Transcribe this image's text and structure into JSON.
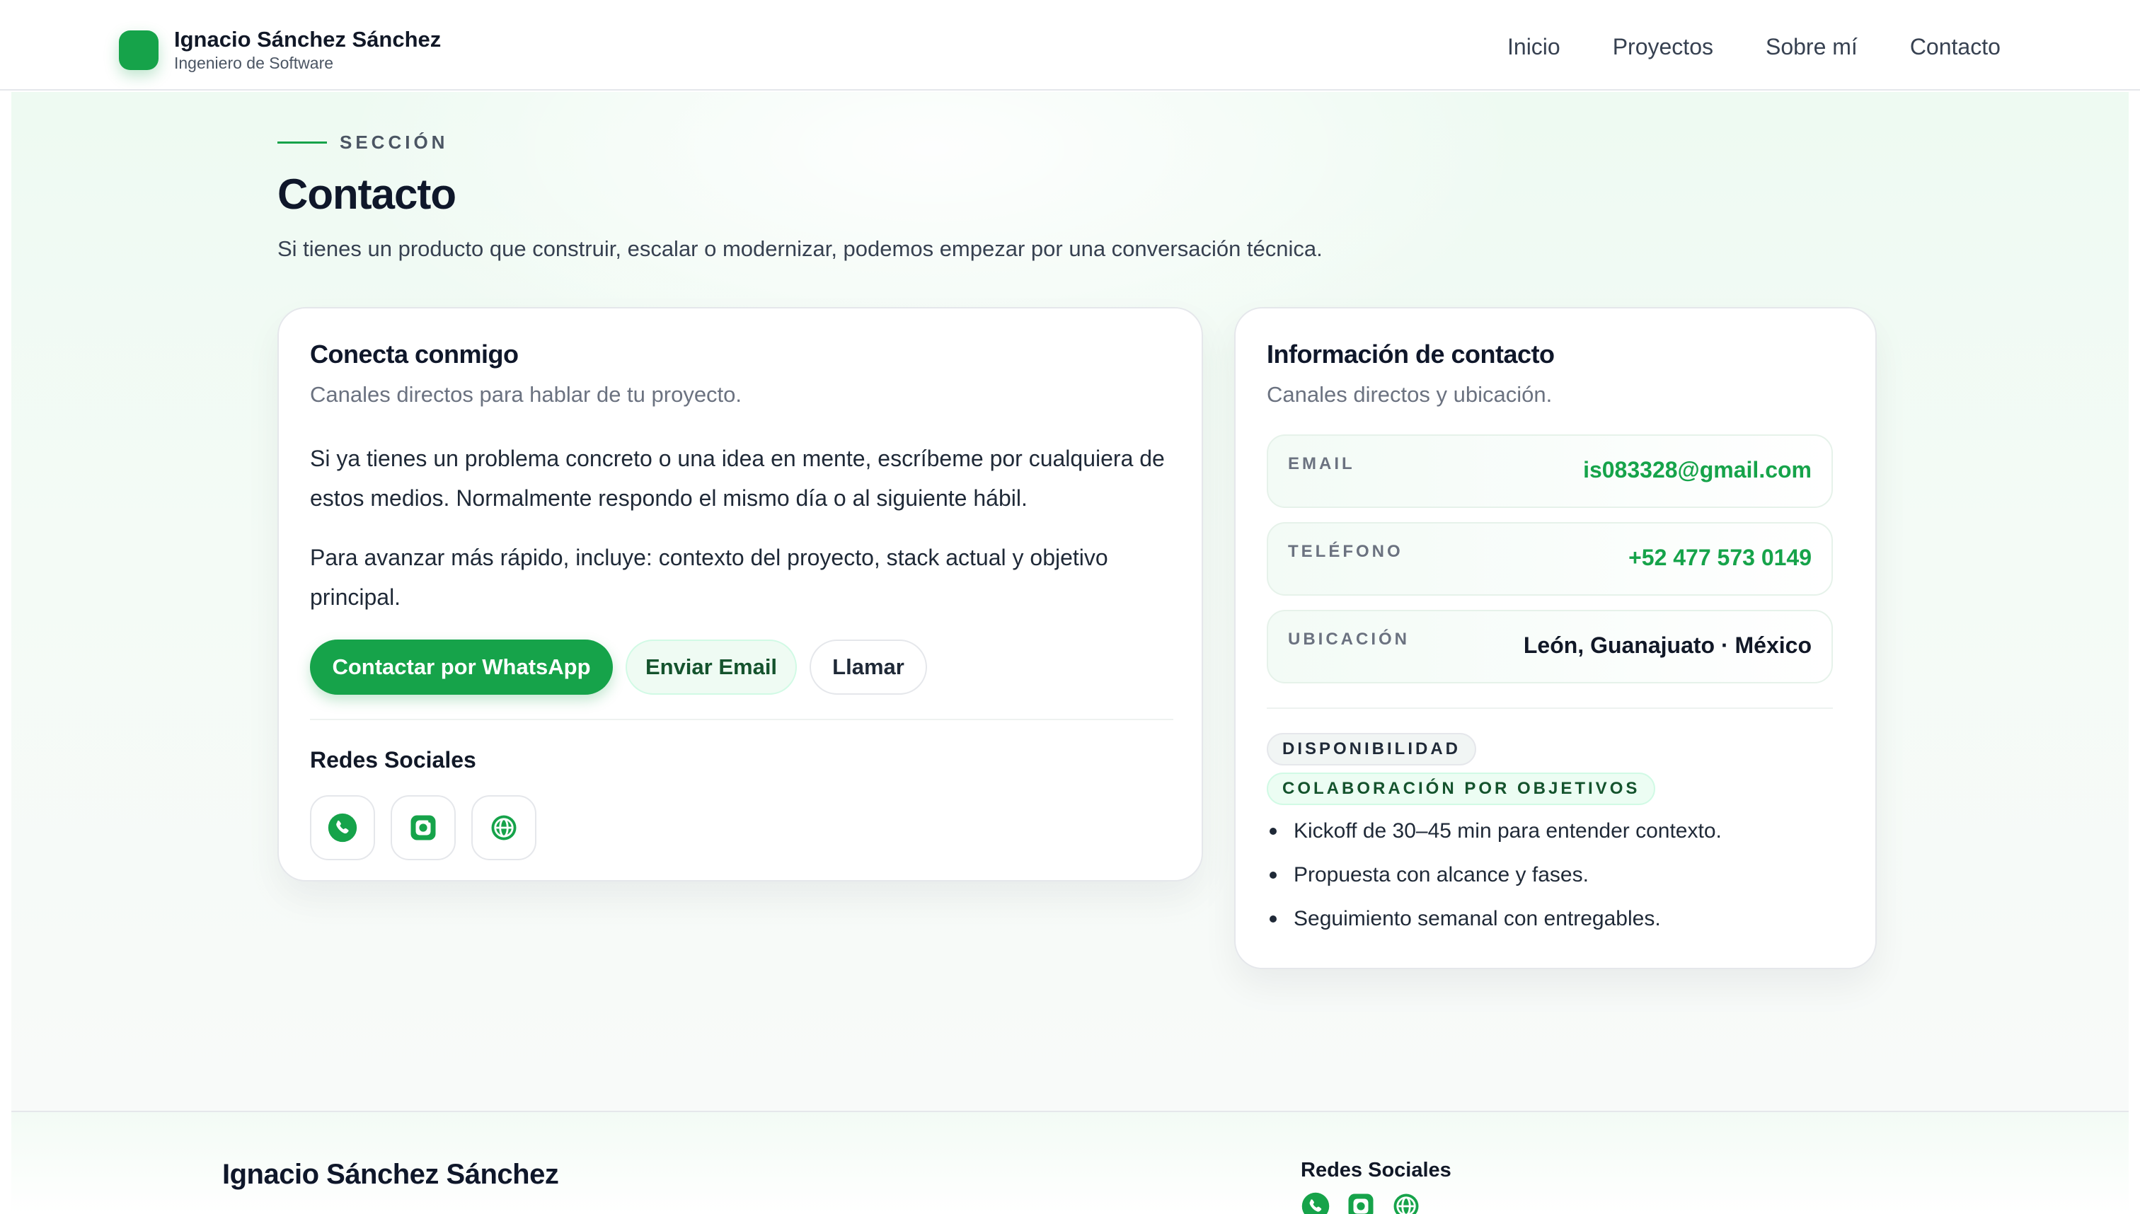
{
  "header": {
    "brand_name": "Ignacio Sánchez Sánchez",
    "brand_role": "Ingeniero de Software",
    "nav": [
      "Inicio",
      "Proyectos",
      "Sobre mí",
      "Contacto"
    ]
  },
  "section": {
    "eyebrow": "SECCIÓN",
    "title": "Contacto",
    "subtitle": "Si tienes un producto que construir, escalar o modernizar, podemos empezar por una conversación técnica."
  },
  "connect_card": {
    "title": "Conecta conmigo",
    "subtitle": "Canales directos para hablar de tu proyecto.",
    "paragraph1": "Si ya tienes un problema concreto o una idea en mente, escríbeme por cualquiera de estos medios. Normalmente respondo el mismo día o al siguiente hábil.",
    "paragraph2": "Para avanzar más rápido, incluye: contexto del proyecto, stack actual y objetivo principal.",
    "buttons": {
      "whatsapp": "Contactar por WhatsApp",
      "email": "Enviar Email",
      "call": "Llamar"
    },
    "social_title": "Redes Sociales",
    "social_icons": [
      "whatsapp-icon",
      "instagram-icon",
      "web-icon"
    ]
  },
  "info_card": {
    "title": "Información de contacto",
    "subtitle": "Canales directos y ubicación.",
    "rows": [
      {
        "label": "EMAIL",
        "value": "is083328@gmail.com"
      },
      {
        "label": "TELÉFONO",
        "value": "+52 477 573 0149"
      },
      {
        "label": "UBICACIÓN",
        "value": "León, Guanajuato · México"
      }
    ],
    "availability_badge": "DISPONIBILIDAD",
    "collaboration_badge": "COLABORACIÓN POR OBJETIVOS",
    "bullets": [
      "Kickoff de 30–45 min para entender contexto.",
      "Propuesta con alcance y fases.",
      "Seguimiento semanal con entregables."
    ]
  },
  "footer": {
    "name": "Ignacio Sánchez Sánchez",
    "social_title": "Redes Sociales"
  },
  "colors": {
    "accent": "#16a34a",
    "accent_dark": "#14532d",
    "text_dark": "#0f172a",
    "muted": "#6b7280"
  }
}
